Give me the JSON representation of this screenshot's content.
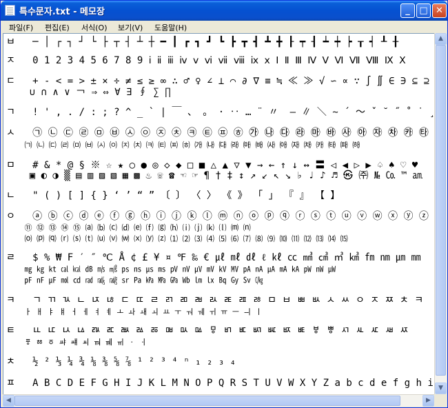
{
  "window": {
    "title": "특수문자.txt - 메모장",
    "controls": {
      "minimize": "_",
      "maximize": "□",
      "close": "✕"
    }
  },
  "menu": [
    {
      "label": "파일(F)"
    },
    {
      "label": "편집(E)"
    },
    {
      "label": "서식(O)"
    },
    {
      "label": "보기(V)"
    },
    {
      "label": "도움말(H)"
    }
  ],
  "editor": {
    "lines": [
      "ㅂ   ─ │ ┌ ┐ ┘ └ ├ ┬ ┤ ┴ ┼ ━ ┃ ┏ ┓ ┛ ┗ ┣ ┳ ┫ ┻ ╋ ┠ ┯ ┨ ┷ ┿ ┝ ┰ ┥ ┸ ╂",
      "ㅈ   0 1 2 3 4 5 6 7 8 9 ⅰ ⅱ ⅲ ⅳ ⅴ ⅵ ⅶ ⅷ ⅸ ⅹ Ⅰ Ⅱ Ⅲ Ⅳ Ⅴ Ⅵ Ⅶ Ⅷ Ⅸ Ⅹ",
      "ㄷ   + - < = > ± × ÷ ≠ ≤ ≥ ∞ ∴ ♂ ♀ ∠ ⊥ ⌒ ∂ ∇ ≡ ≒ ≪ ≫ √ ∽ ∝ ∵ ∫ ∬ ∈ ∋ ⊆ ⊇ ⊂ ⊃",
      "    ∪ ∩ ∧ ∨ ￢ ⇒ ⇔ ∀ ∃ ∮ ∑ ∏",
      "ㄱ   ! ' , . / : ; ? ^ _ ` | ￣ 、 。 · ‥ … ¨ 〃 ­ ― ∥ ＼ ∼ ´ ～ ˇ ˘ ˝ ˚ ˙ ¸ ˛ ¡ ¿ ː",
      "ㅅ   ㉠ ㉡ ㉢ ㉣ ㉤ ㉥ ㉦ ㉧ ㉨ ㉩ ㉪ ㉫ ㉬ ㉭ ㉮ ㉯ ㉰ ㉱ ㉲ ㉳ ㉴ ㉵ ㉶ ㉷ ㉸ ㉹ ㉺ ㉻",
      "    ㈀ ㈁ ㈂ ㈃ ㈄ ㈅ ㈆ ㈇ ㈈ ㈉ ㈊ ㈋ ㈌ ㈍ ㈎ ㈏ ㈐ ㈑ ㈒ ㈓ ㈔ ㈕ ㈖ ㈗ ㈘ ㈙ ㈚ ㈛",
      "ㅁ   # & * @ § ※ ☆ ★ ○ ● ◎ ◇ ◆ □ ■ △ ▲ ▽ ▼ → ← ↑ ↓ ↔ 〓 ◁ ◀ ▷ ▶ ♤ ♠ ♡ ♥",
      "    ▣ ◐ ◑ ▒ ▤ ▥ ▨ ▧ ▦ ▩ ♨ ☏ ☎ ☜ ☞ ¶ † ‡ ↕ ↗ ↙ ↖ ↘ ♭ ♩ ♪ ♬ ㉿ ㈜ № ㏇ ™ ㏂",
      "ㄴ   \" ( ) [ ] { } ‘ ’ “ ” 〔 〕 〈 〉 《 》 「 」 『 』 【 】",
      "ㅇ   ⓐ ⓑ ⓒ ⓓ ⓔ ⓕ ⓖ ⓗ ⓘ ⓙ ⓚ ⓛ ⓜ ⓝ ⓞ ⓟ ⓠ ⓡ ⓢ ⓣ ⓤ ⓥ ⓦ ⓧ ⓨ ⓩ ① ② ③ ④ ⑤",
      "    ⑪ ⑫ ⑬ ⑭ ⑮ ⒜ ⒝ ⒞ ⒟ ⒠ ⒡ ⒢ ⒣ ⒤ ⒥ ⒦ ⒧ ⒨ ⒩",
      "    ⒪ ⒫ ⒬ ⒭ ⒮ ⒯ ⒰ ⒱ ⒲ ⒳ ⒴ ⒵ ⑴ ⑵ ⑶ ⑷ ⑸ ⑹ ⑺ ⑻ ⑼ ⑽ ⑾ ⑿ ⒀ ⒁ ⒂",
      "ㄹ   $ % ₩ F ′ ″ ℃ Å ¢ £ ¥ ¤ ℉ ‰ € ㎕ ㎖ ㎗ ℓ ㎘ ㏄ ㎣ ㎤ ㎥ ㎦ ㎙ ㎚ ㎛ ㎜",
      "    ㎎ ㎏ ㏏ ㎈ ㎉ ㏈ ㎧ ㎨ ㎰ ㎱ ㎲ ㎳ ㎴ ㎵ ㎶ ㎷ ㎸ ㎹ ㎀ ㎁ ㎂ ㎃ ㎄ ㎺ ㎻ ㎼",
      "    ㎊ ㎋ ㎌ ㏖ ㏅ ㎭ ㎮ ㎯ ㏛ ㎩ ㎪ ㎫ ㎬ ㏝ ㏐ ㏓ ㏃ ㏉ ㏜ ㏆",
      "ㅋ   ㄱ ㄲ ㄳ ㄴ ㄵ ㄶ ㄷ ㄸ ㄹ ㄺ ㄻ ㄼ ㄽ ㄾ ㄿ ㅀ ㅁ ㅂ ㅃ ㅄ ㅅ ㅆ ㅇ ㅈ ㅉ ㅊ ㅋ",
      "    ㅏ ㅐ ㅑ ㅒ ㅓ ㅔ ㅕ ㅖ ㅗ ㅘ ㅙ ㅚ ㅛ ㅜ ㅝ ㅞ ㅟ ㅠ ㅡ ㅢ ㅣ",
      "ㅌ   ㅥ ㅦ ㅧ ㅨ ㅩ ㅪ ㅫ ㅬ ㅭ ㅮ ㅯ ㅰ ㅱ ㅲ ㅳ ㅴ ㅵ ㅶ ㅷ ㅸ ㅹ ㅺ ㅻ ㅼ ㅽ ㅾ",
      "    ㆄ ㆅ ㆆ ㆇ ㆈ ㆉ ㆊ ㆋ ㆌ ㆍ ㆎ",
      "ㅊ   ½ ² ⅓ ¼ ¾ ⅛ ⅜ ⅝ ⅞ ¹ ² ³ ⁴ ⁿ ₁ ₂ ₃ ₄",
      "ㅍ   A B C D E F G H I J K L M N O P Q R S T U V W X Y Z a b c d e f g h i j k l"
    ]
  }
}
